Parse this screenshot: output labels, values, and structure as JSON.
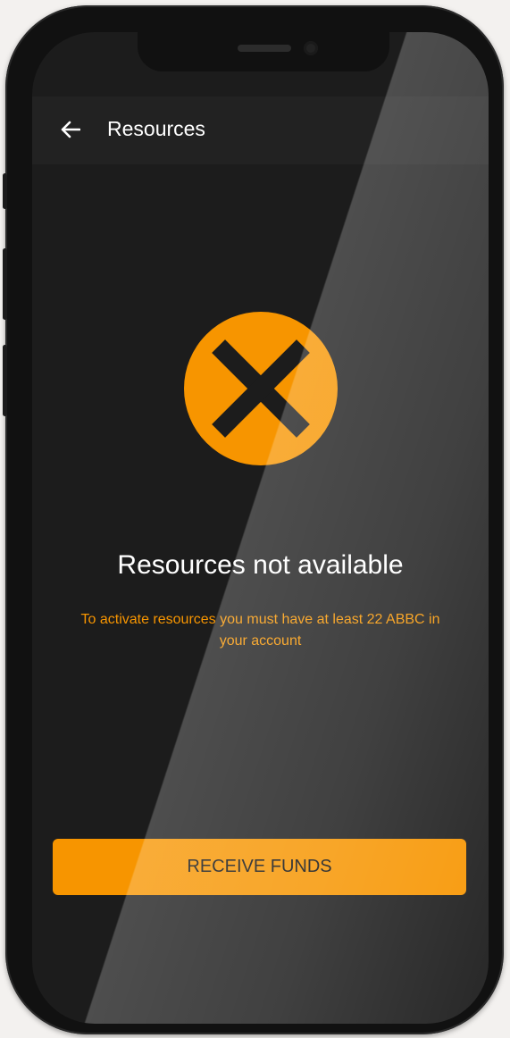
{
  "header": {
    "back_icon": "arrow-left-icon",
    "title": "Resources"
  },
  "status": {
    "icon": "close-x-icon",
    "icon_color": "#f79500",
    "headline": "Resources not available",
    "message": "To activate resources you must have at least 22 ABBC in your account"
  },
  "actions": {
    "receive_funds_label": "RECEIVE FUNDS"
  },
  "colors": {
    "accent": "#f79500",
    "screen_background": "#1c1c1c",
    "appbar_background": "#222222",
    "text_primary": "#ffffff"
  }
}
